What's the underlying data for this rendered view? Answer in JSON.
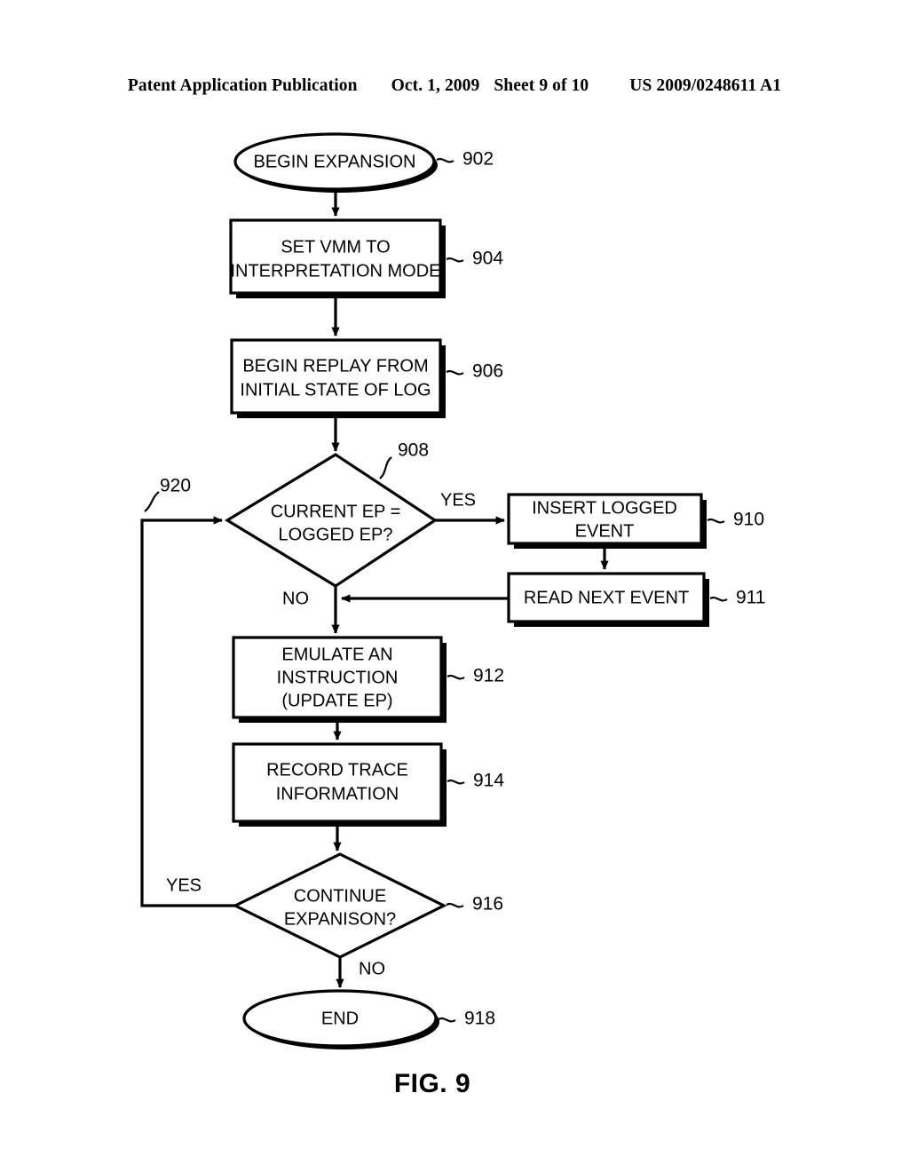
{
  "header": {
    "publication": "Patent Application Publication",
    "date": "Oct. 1, 2009",
    "sheet": "Sheet 9 of 10",
    "patent_number": "US 2009/0248611 A1"
  },
  "figure": {
    "caption": "FIG. 9",
    "nodes": [
      {
        "id": "902",
        "type": "terminator",
        "label": "BEGIN EXPANSION",
        "ref": "902"
      },
      {
        "id": "904",
        "type": "process",
        "label_line1": "SET VMM TO",
        "label_line2": "INTERPRETATION MODE",
        "ref": "904"
      },
      {
        "id": "906",
        "type": "process",
        "label_line1": "BEGIN REPLAY FROM",
        "label_line2": "INITIAL STATE OF LOG",
        "ref": "906"
      },
      {
        "id": "908",
        "type": "decision",
        "label_line1": "CURRENT EP =",
        "label_line2": "LOGGED EP?",
        "ref": "908"
      },
      {
        "id": "910",
        "type": "process",
        "label_line1": "INSERT LOGGED",
        "label_line2": "EVENT",
        "ref": "910"
      },
      {
        "id": "911",
        "type": "process",
        "label_line1": "READ NEXT EVENT",
        "ref": "911"
      },
      {
        "id": "912",
        "type": "process",
        "label_line1": "EMULATE AN",
        "label_line2": "INSTRUCTION",
        "label_line3": "(UPDATE EP)",
        "ref": "912"
      },
      {
        "id": "914",
        "type": "process",
        "label_line1": "RECORD TRACE",
        "label_line2": "INFORMATION",
        "ref": "914"
      },
      {
        "id": "916",
        "type": "decision",
        "label_line1": "CONTINUE",
        "label_line2": "EXPANISON?",
        "ref": "916"
      },
      {
        "id": "918",
        "type": "terminator",
        "label": "END",
        "ref": "918"
      }
    ],
    "edge_labels": {
      "decision_908_yes": "YES",
      "decision_908_no": "NO",
      "decision_916_yes": "YES",
      "decision_916_no": "NO",
      "loop_ref": "920"
    }
  }
}
